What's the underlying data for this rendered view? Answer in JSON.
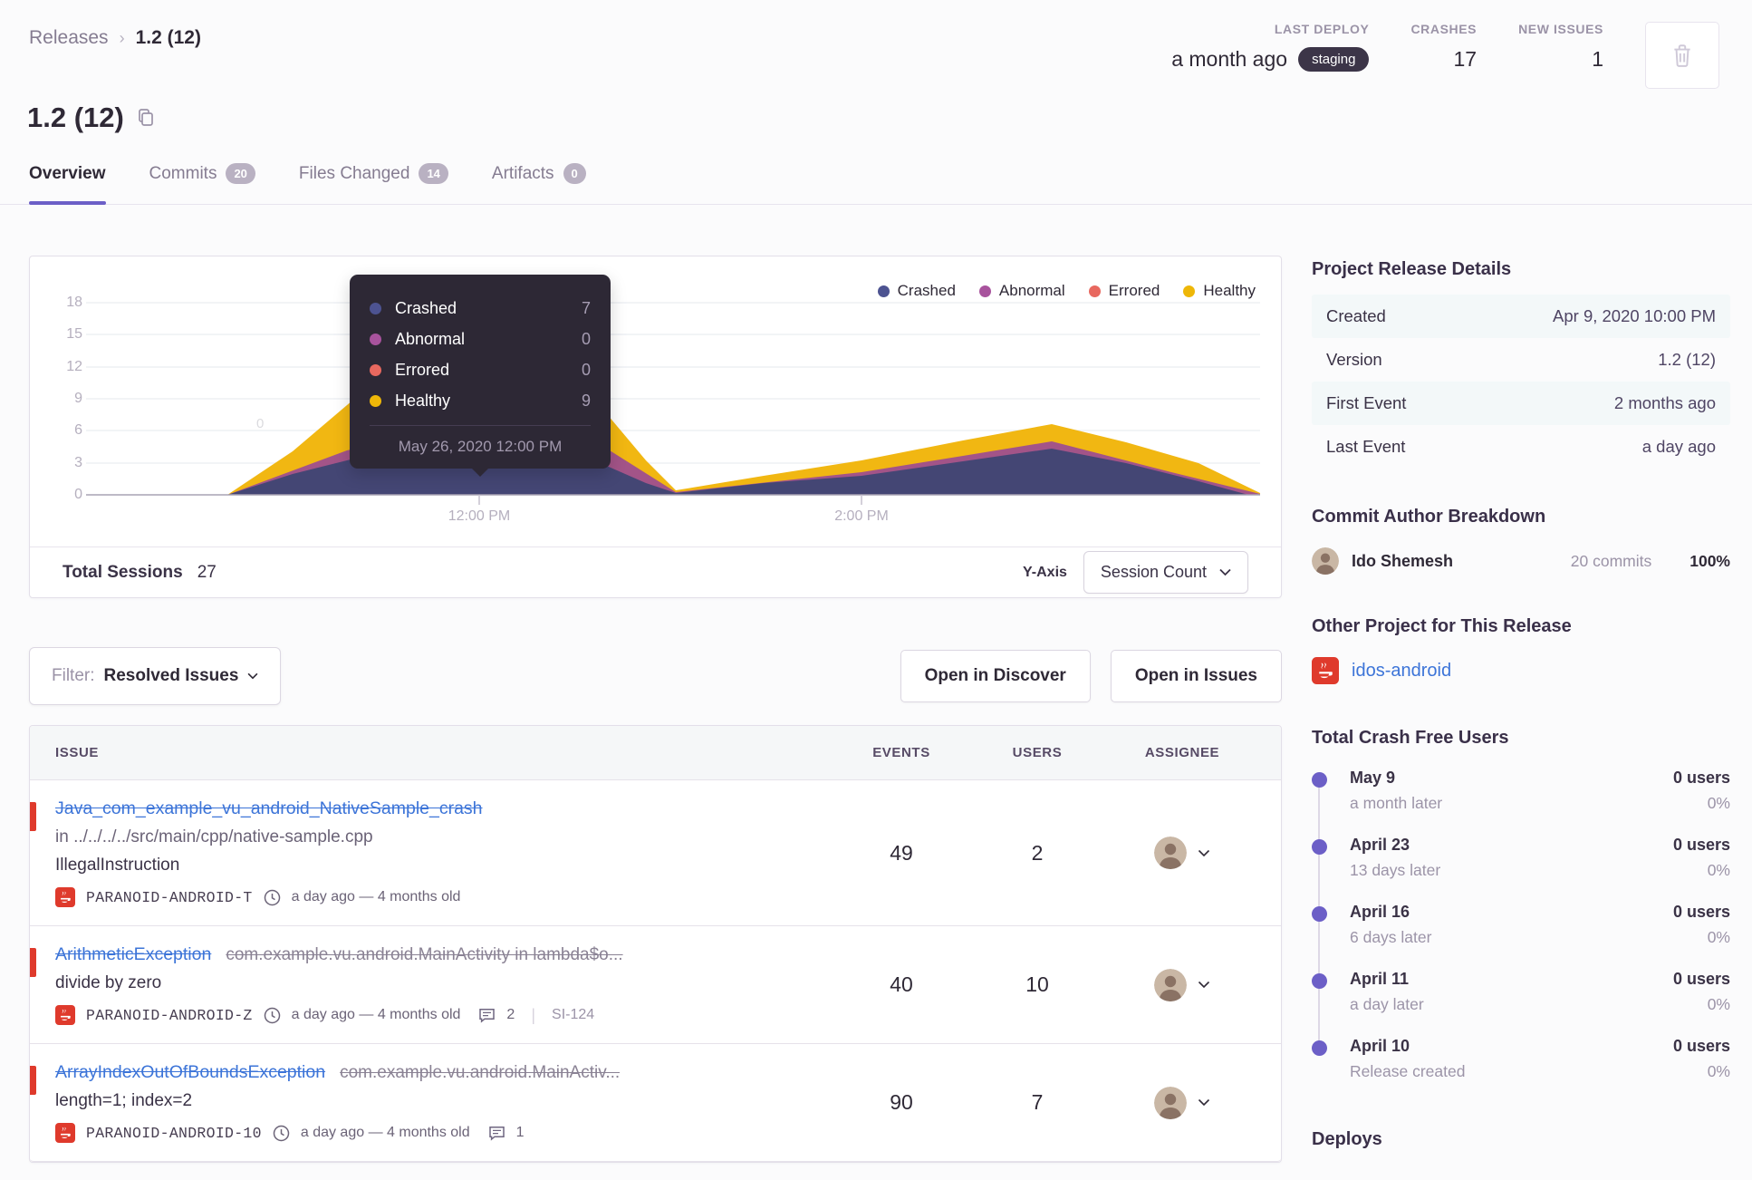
{
  "breadcrumb": {
    "parent": "Releases",
    "current": "1.2 (12)"
  },
  "header_stats": {
    "last_deploy": {
      "label": "LAST DEPLOY",
      "value": "a month ago",
      "env": "staging"
    },
    "crashes": {
      "label": "CRASHES",
      "value": "17"
    },
    "new_issues": {
      "label": "NEW ISSUES",
      "value": "1"
    }
  },
  "page": {
    "title": "1.2 (12)"
  },
  "tabs": [
    {
      "label": "Overview"
    },
    {
      "label": "Commits",
      "count": "20"
    },
    {
      "label": "Files Changed",
      "count": "14"
    },
    {
      "label": "Artifacts",
      "count": "0"
    }
  ],
  "chart": {
    "legend": [
      {
        "label": "Crashed",
        "color": "#4d5391"
      },
      {
        "label": "Abnormal",
        "color": "#a8539d"
      },
      {
        "label": "Errored",
        "color": "#e8685f"
      },
      {
        "label": "Healthy",
        "color": "#eeb708"
      }
    ],
    "y_ticks": [
      "18",
      "15",
      "12",
      "9",
      "6",
      "3",
      "0"
    ],
    "x_ticks": [
      "12:00 PM",
      "2:00 PM"
    ],
    "faint_label": "0",
    "tooltip": {
      "rows": [
        {
          "label": "Crashed",
          "value": "7"
        },
        {
          "label": "Abnormal",
          "value": "0"
        },
        {
          "label": "Errored",
          "value": "0"
        },
        {
          "label": "Healthy",
          "value": "9"
        }
      ],
      "date": "May 26, 2020 12:00 PM"
    },
    "footer": {
      "total_sessions_label": "Total Sessions",
      "total_sessions_value": "27",
      "y_axis_label": "Y-Axis",
      "y_axis_value": "Session Count"
    }
  },
  "chart_data": {
    "type": "area",
    "stacked": true,
    "title": "Release sessions over time",
    "ylabel": "Session Count",
    "ylim": [
      0,
      18
    ],
    "x_ticks_visible": [
      "12:00 PM",
      "2:00 PM"
    ],
    "x": [
      "11:00 AM",
      "11:30 AM",
      "12:00 PM",
      "12:30 PM",
      "1:00 PM",
      "1:30 PM",
      "2:00 PM",
      "2:30 PM",
      "3:00 PM",
      "3:30 PM"
    ],
    "series": [
      {
        "name": "Crashed",
        "color": "#444674",
        "values": [
          0,
          4,
          7,
          4,
          0,
          0,
          2,
          4,
          2,
          0
        ]
      },
      {
        "name": "Abnormal",
        "color": "#a35488",
        "values": [
          0,
          0,
          0,
          0,
          0,
          0,
          0.3,
          0.6,
          0.3,
          0
        ]
      },
      {
        "name": "Errored",
        "color": "#ea665c",
        "values": [
          0,
          0,
          0,
          0,
          0,
          0,
          0,
          0,
          0,
          0
        ]
      },
      {
        "name": "Healthy",
        "color": "#f1b712",
        "values": [
          0,
          5,
          9,
          5,
          0,
          0.5,
          1.5,
          2.5,
          1.5,
          0
        ]
      }
    ],
    "highlighted_point": {
      "x": "May 26, 2020 12:00 PM",
      "Crashed": 7,
      "Abnormal": 0,
      "Errored": 0,
      "Healthy": 9
    },
    "total_sessions": 27,
    "legend_position": "top-right",
    "grid": true
  },
  "filter_bar": {
    "filter_label": "Filter:",
    "filter_value": "Resolved Issues",
    "open_discover": "Open in Discover",
    "open_issues": "Open in Issues"
  },
  "issues": {
    "headers": [
      "ISSUE",
      "EVENTS",
      "USERS",
      "ASSIGNEE"
    ],
    "rows": [
      {
        "title": "Java_com_example_vu_android_NativeSample_crash",
        "suffix": "",
        "location": "in ../../../../src/main/cpp/native-sample.cpp",
        "culprit": "IllegalInstruction",
        "project": "PARANOID-ANDROID-T",
        "age": "a day ago — 4 months old",
        "comments": "",
        "annotation": "",
        "events": "49",
        "users": "2"
      },
      {
        "title": "ArithmeticException",
        "suffix": "com.example.vu.android.MainActivity in lambda$o...",
        "location": "",
        "culprit": "divide by zero",
        "project": "PARANOID-ANDROID-Z",
        "age": "a day ago — 4 months old",
        "comments": "2",
        "annotation": "SI-124",
        "events": "40",
        "users": "10"
      },
      {
        "title": "ArrayIndexOutOfBoundsException",
        "suffix": "com.example.vu.android.MainActiv...",
        "location": "",
        "culprit": "length=1; index=2",
        "project": "PARANOID-ANDROID-10",
        "age": "a day ago — 4 months old",
        "comments": "1",
        "annotation": "",
        "events": "90",
        "users": "7"
      }
    ]
  },
  "sidebar": {
    "release_details": {
      "heading": "Project Release Details",
      "rows": [
        {
          "label": "Created",
          "value": "Apr 9, 2020 10:00 PM"
        },
        {
          "label": "Version",
          "value": "1.2 (12)"
        },
        {
          "label": "First Event",
          "value": "2 months ago"
        },
        {
          "label": "Last Event",
          "value": "a day ago"
        }
      ]
    },
    "commit_authors": {
      "heading": "Commit Author Breakdown",
      "author": {
        "name": "Ido Shemesh",
        "commits": "20 commits",
        "percent": "100%"
      }
    },
    "other_project": {
      "heading": "Other Project for This Release",
      "link": "idos-android"
    },
    "crash_free": {
      "heading": "Total Crash Free Users",
      "items": [
        {
          "date": "May 9",
          "sub": "a month later",
          "users": "0 users",
          "pct": "0%"
        },
        {
          "date": "April 23",
          "sub": "13 days later",
          "users": "0 users",
          "pct": "0%"
        },
        {
          "date": "April 16",
          "sub": "6 days later",
          "users": "0 users",
          "pct": "0%"
        },
        {
          "date": "April 11",
          "sub": "a day later",
          "users": "0 users",
          "pct": "0%"
        },
        {
          "date": "April 10",
          "sub": "Release created",
          "users": "0 users",
          "pct": "0%"
        }
      ]
    },
    "deploys_heading": "Deploys"
  },
  "colors": {
    "accent_purple": "#6c5fc7",
    "crashed": "#444674",
    "abnormal": "#a35488",
    "errored": "#ea665c",
    "healthy": "#f1b712",
    "link_blue": "#3c74d8",
    "alert_red": "#df3a2c",
    "tooltip_bg": "#2d2835",
    "env_pill_bg": "#3c3548"
  }
}
